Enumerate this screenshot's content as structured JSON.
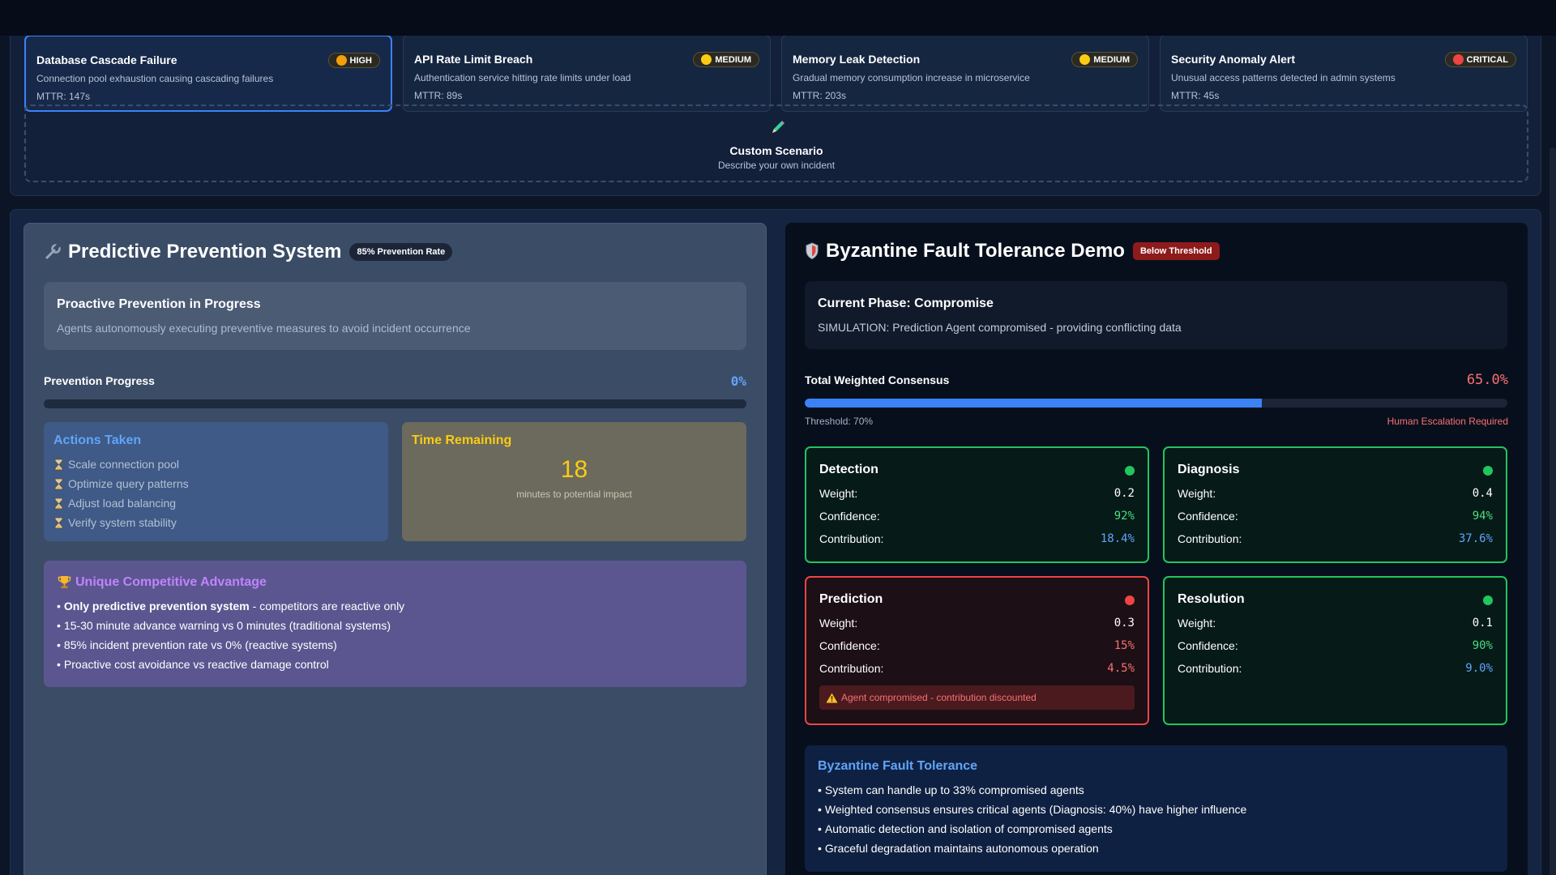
{
  "scenarios": [
    {
      "title": "Database Cascade Failure",
      "severity": "HIGH",
      "severity_color": "#f59e0b",
      "desc": "Connection pool exhaustion causing cascading failures",
      "mttr": "MTTR: 147s",
      "active": true
    },
    {
      "title": "API Rate Limit Breach",
      "severity": "MEDIUM",
      "severity_color": "#facc15",
      "desc": "Authentication service hitting rate limits under load",
      "mttr": "MTTR: 89s",
      "active": false
    },
    {
      "title": "Memory Leak Detection",
      "severity": "MEDIUM",
      "severity_color": "#facc15",
      "desc": "Gradual memory consumption increase in microservice",
      "mttr": "MTTR: 203s",
      "active": false
    },
    {
      "title": "Security Anomaly Alert",
      "severity": "CRITICAL",
      "severity_color": "#ef4444",
      "desc": "Unusual access patterns detected in admin systems",
      "mttr": "MTTR: 45s",
      "active": false
    }
  ],
  "custom": {
    "icon": "pencil-icon",
    "title": "Custom Scenario",
    "subtitle": "Describe your own incident"
  },
  "prevention": {
    "icon": "wrench-icon",
    "title": "Predictive Prevention System",
    "rate_badge": "85% Prevention Rate",
    "status_title": "Proactive Prevention in Progress",
    "status_sub": "Agents autonomously executing preventive measures to avoid incident occurrence",
    "progress_label": "Prevention Progress",
    "progress_value": "0%",
    "progress_fraction": 0,
    "actions_title": "Actions Taken",
    "actions": [
      "Scale connection pool",
      "Optimize query patterns",
      "Adjust load balancing",
      "Verify system stability"
    ],
    "time_title": "Time Remaining",
    "time_value": "18",
    "time_unit": "minutes to potential impact",
    "advantage_title": "Unique Competitive Advantage",
    "advantage_icon": "trophy-icon",
    "advantage_lead_bold": "Only predictive prevention system",
    "advantage_lead_rest": "- competitors are reactive only",
    "advantages": [
      "15-30 minute advance warning vs 0 minutes (traditional systems)",
      "85% incident prevention rate vs 0% (reactive systems)",
      "Proactive cost avoidance vs reactive damage control"
    ]
  },
  "byzantine": {
    "icon": "shield-icon",
    "title": "Byzantine Fault Tolerance Demo",
    "status_badge": "Below Threshold",
    "phase_title": "Current Phase: Compromise",
    "phase_sub": "SIMULATION: Prediction Agent compromised - providing conflicting data",
    "consensus_label": "Total Weighted Consensus",
    "consensus_value": "65.0%",
    "consensus_fraction": 0.65,
    "threshold_label": "Threshold: 70%",
    "escalation_label": "Human Escalation Required",
    "row_labels": {
      "weight": "Weight:",
      "confidence": "Confidence:",
      "contribution": "Contribution:"
    },
    "agents": [
      {
        "name": "Detection",
        "weight": "0.2",
        "confidence": "92%",
        "contribution": "18.4%",
        "status": "healthy"
      },
      {
        "name": "Diagnosis",
        "weight": "0.4",
        "confidence": "94%",
        "contribution": "37.6%",
        "status": "healthy"
      },
      {
        "name": "Prediction",
        "weight": "0.3",
        "confidence": "15%",
        "contribution": "4.5%",
        "status": "compromised",
        "warning": "Agent compromised - contribution discounted"
      },
      {
        "name": "Resolution",
        "weight": "0.1",
        "confidence": "90%",
        "contribution": "9.0%",
        "status": "healthy"
      }
    ],
    "bft_title": "Byzantine Fault Tolerance",
    "bft_items": [
      "System can handle up to 33% compromised agents",
      "Weighted consensus ensures critical agents (Diagnosis: 40%) have higher influence",
      "Automatic detection and isolation of compromised agents",
      "Graceful degradation maintains autonomous operation"
    ]
  },
  "colors": {
    "accent": "#3b82f6",
    "healthy": "#22c55e",
    "compromised": "#ef4444",
    "warning": "#facc15",
    "purple": "#c084fc"
  }
}
